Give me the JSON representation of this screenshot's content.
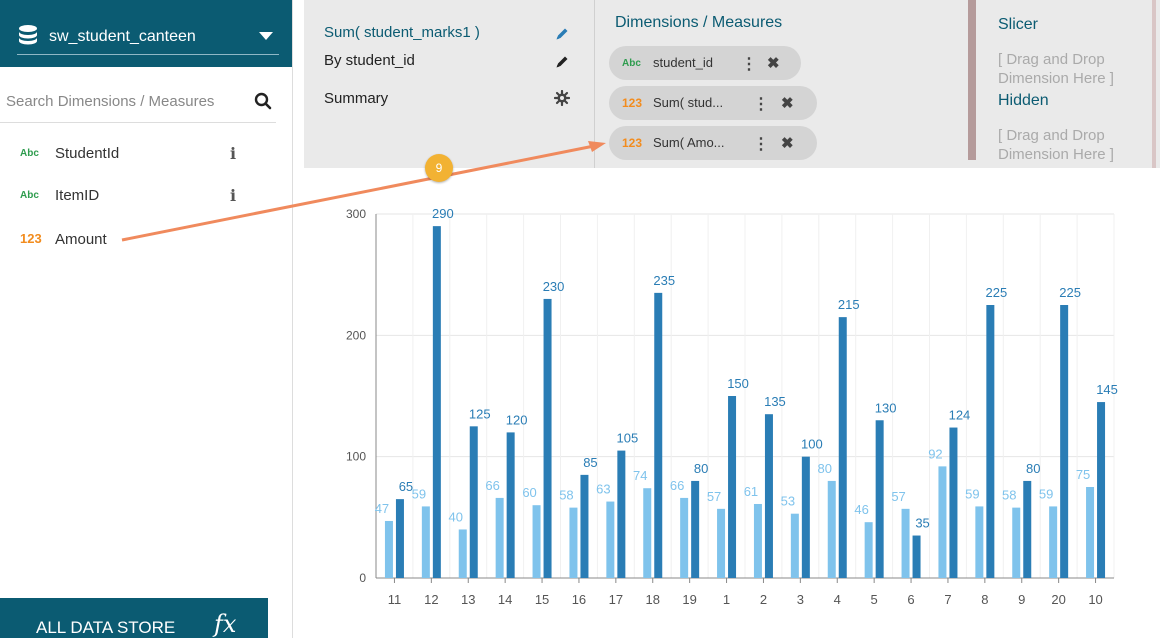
{
  "datastore": {
    "name": "sw_student_canteen",
    "icon": "database-icon"
  },
  "search": {
    "placeholder": "Search Dimensions / Measures"
  },
  "fields": [
    {
      "type": "Abc",
      "name": "StudentId"
    },
    {
      "type": "Abc",
      "name": "ItemID"
    },
    {
      "type": "123",
      "name": "Amount"
    }
  ],
  "footer": {
    "label": "ALL DATA STORE",
    "fx": "fx"
  },
  "summary": {
    "measure": "Sum( student_marks1 )",
    "by": "By student_id",
    "summary": "Summary"
  },
  "dimensions": {
    "title": "Dimensions / Measures",
    "chips": [
      {
        "type": "Abc",
        "label": "student_id"
      },
      {
        "type": "123",
        "label": "Sum( stud..."
      },
      {
        "type": "123",
        "label": "Sum( Amo..."
      }
    ]
  },
  "slicer": {
    "title": "Slicer",
    "drop": "[ Drag and Drop Dimension Here ]"
  },
  "hidden": {
    "title": "Hidden",
    "drop": "[ Drag and Drop Dimension Here ]"
  },
  "step_badge": "9",
  "colors": {
    "brand": "#0b5b72",
    "series_light": "#7fc3ec",
    "series_dark": "#2a7db5",
    "arrow": "#f08a5d",
    "badge": "#f2b233"
  },
  "chart_data": {
    "type": "bar",
    "categories": [
      "11",
      "12",
      "13",
      "14",
      "15",
      "16",
      "17",
      "18",
      "19",
      "1",
      "2",
      "3",
      "4",
      "5",
      "6",
      "7",
      "8",
      "9",
      "20",
      "10"
    ],
    "series": [
      {
        "values": [
          47,
          59,
          40,
          66,
          60,
          58,
          63,
          74,
          66,
          57,
          61,
          53,
          80,
          46,
          57,
          92,
          59,
          58,
          59,
          75
        ]
      },
      {
        "values": [
          65,
          290,
          125,
          120,
          230,
          85,
          105,
          235,
          80,
          150,
          135,
          100,
          215,
          130,
          35,
          124,
          225,
          80,
          225,
          145
        ]
      }
    ],
    "labels": [
      [
        "47",
        "59",
        "40",
        "66",
        "60",
        "58",
        "63",
        "74",
        "66",
        "57",
        "61",
        "53",
        "80",
        "46",
        "57",
        "92",
        "59",
        "58",
        "59",
        "75"
      ],
      [
        "65",
        "290",
        "125",
        "120",
        "230",
        "85",
        "105",
        "235",
        "80",
        "150",
        "135",
        "100",
        "215",
        "130",
        "35",
        "124",
        "225",
        "80",
        "225",
        "145"
      ]
    ],
    "yticks": [
      "0",
      "100",
      "200",
      "300"
    ],
    "ylim": [
      0,
      300
    ],
    "grid": true
  }
}
